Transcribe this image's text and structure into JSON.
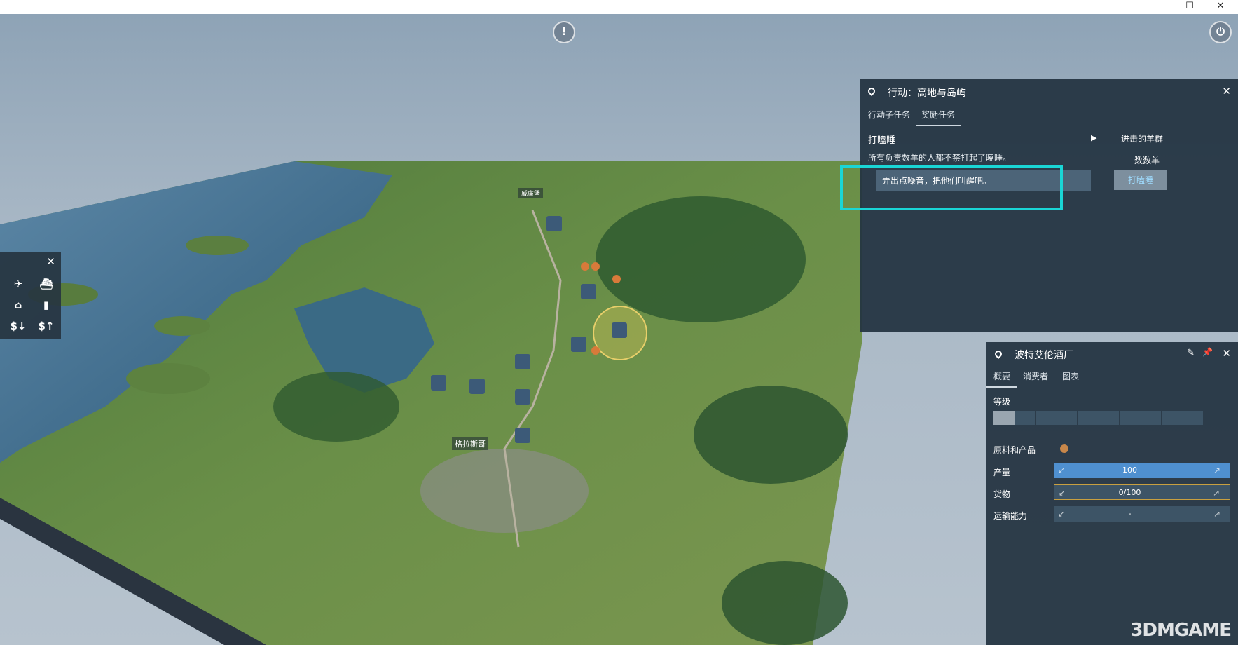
{
  "window": {
    "minimize": "–",
    "maximize": "☐",
    "close": "✕"
  },
  "hud": {
    "alert_icon": "!",
    "power_icon": "⏻"
  },
  "map": {
    "town_label": "格拉斯哥",
    "place_label": "威廉堡"
  },
  "toolbar": {
    "close": "✕",
    "icons": [
      "airplane-icon",
      "ship-icon",
      "depot-icon",
      "signal-icon",
      "money-down-icon",
      "money-up-icon"
    ],
    "glyphs": [
      "✈",
      "⛴",
      "⌂",
      "▮",
      "$↓",
      "$↑"
    ]
  },
  "mission_panel": {
    "title": "行动：高地与岛屿",
    "close": "✕",
    "tabs": [
      "行动子任务",
      "奖励任务"
    ],
    "active_tab": 1,
    "mission_name": "打瞌睡",
    "play_icon": "▶",
    "description": "所有负责数羊的人都不禁打起了瞌睡。",
    "option": "弄出点噪音，把他们叫醒吧。",
    "side_title": "进击的羊群",
    "side_sub": "数数羊",
    "side_button": "打瞌睡"
  },
  "factory_panel": {
    "title": "波特艾伦酒厂",
    "edit_icon": "✎",
    "pin_icon": "📌",
    "close": "✕",
    "tabs": [
      "概要",
      "消费者",
      "图表"
    ],
    "active_tab": 0,
    "level_label": "等级",
    "level_current": 1,
    "level_max": 5,
    "materials_label": "原料和产品",
    "rows": [
      {
        "label": "产量",
        "value": "100"
      },
      {
        "label": "货物",
        "value": "0/100"
      },
      {
        "label": "运输能力",
        "value": "-"
      }
    ]
  },
  "watermark": "3DMGAME",
  "colors": {
    "highlight": "#1ad6d6",
    "bar_blue": "#4f90d0",
    "bar_gold": "#c8a040",
    "panel": "#24343f"
  }
}
